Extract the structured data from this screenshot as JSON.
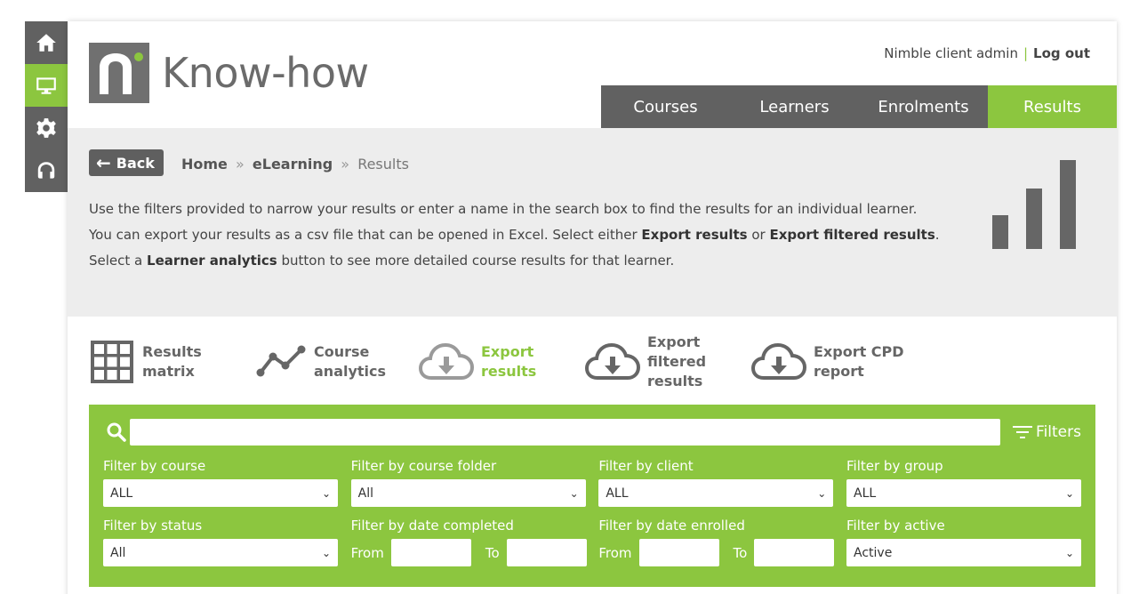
{
  "rail": {
    "items": [
      {
        "name": "home-icon",
        "active": false
      },
      {
        "name": "monitor-icon",
        "active": true
      },
      {
        "name": "gear-icon",
        "active": false
      },
      {
        "name": "headset-icon",
        "active": false
      }
    ]
  },
  "brand": {
    "logo_text": "Know-how",
    "accent": "#8cc63f",
    "nav_dark": "#616161"
  },
  "user": {
    "name": "Nimble client admin",
    "separator": "|",
    "logout_label": "Log out"
  },
  "nav": {
    "tabs": [
      "Courses",
      "Learners",
      "Enrolments",
      "Results"
    ],
    "active": "Results"
  },
  "breadcrumb": {
    "back_label": "Back",
    "home": "Home",
    "sep1": "»",
    "elearning": "eLearning",
    "sep2": "»",
    "current": "Results"
  },
  "intro": {
    "line1": "Use the filters provided to narrow your results or enter a name in the search box to find the results for an individual learner.",
    "line2_a": "You can export your results as a csv file that can be opened in Excel. Select either ",
    "line2_b": "Export results",
    "line2_c": " or ",
    "line2_d": "Export filtered results",
    "line2_e": ".",
    "line3_a": "Select a ",
    "line3_b": "Learner analytics",
    "line3_c": " button to see more detailed course results for that learner."
  },
  "actions": {
    "results_matrix": {
      "l1": "Results",
      "l2": "matrix"
    },
    "course_analytics": {
      "l1": "Course",
      "l2": "analytics"
    },
    "export_results": {
      "l1": "Export",
      "l2": "results"
    },
    "export_filtered": {
      "l1": "Export",
      "l2": "filtered",
      "l3": "results"
    },
    "export_cpd": {
      "l1": "Export CPD",
      "l2": "report"
    }
  },
  "search": {
    "value": "",
    "filters_label": "Filters"
  },
  "filters": {
    "course": {
      "label": "Filter by course",
      "value": "ALL"
    },
    "course_folder": {
      "label": "Filter by course folder",
      "value": "All"
    },
    "client": {
      "label": "Filter by client",
      "value": "ALL"
    },
    "group": {
      "label": "Filter by group",
      "value": "ALL"
    },
    "status": {
      "label": "Filter by status",
      "value": "All"
    },
    "date_completed": {
      "label": "Filter by date completed",
      "from": "From",
      "to": "To"
    },
    "date_enrolled": {
      "label": "Filter by date enrolled",
      "from": "From",
      "to": "To"
    },
    "active": {
      "label": "Filter by active",
      "value": "Active"
    }
  }
}
